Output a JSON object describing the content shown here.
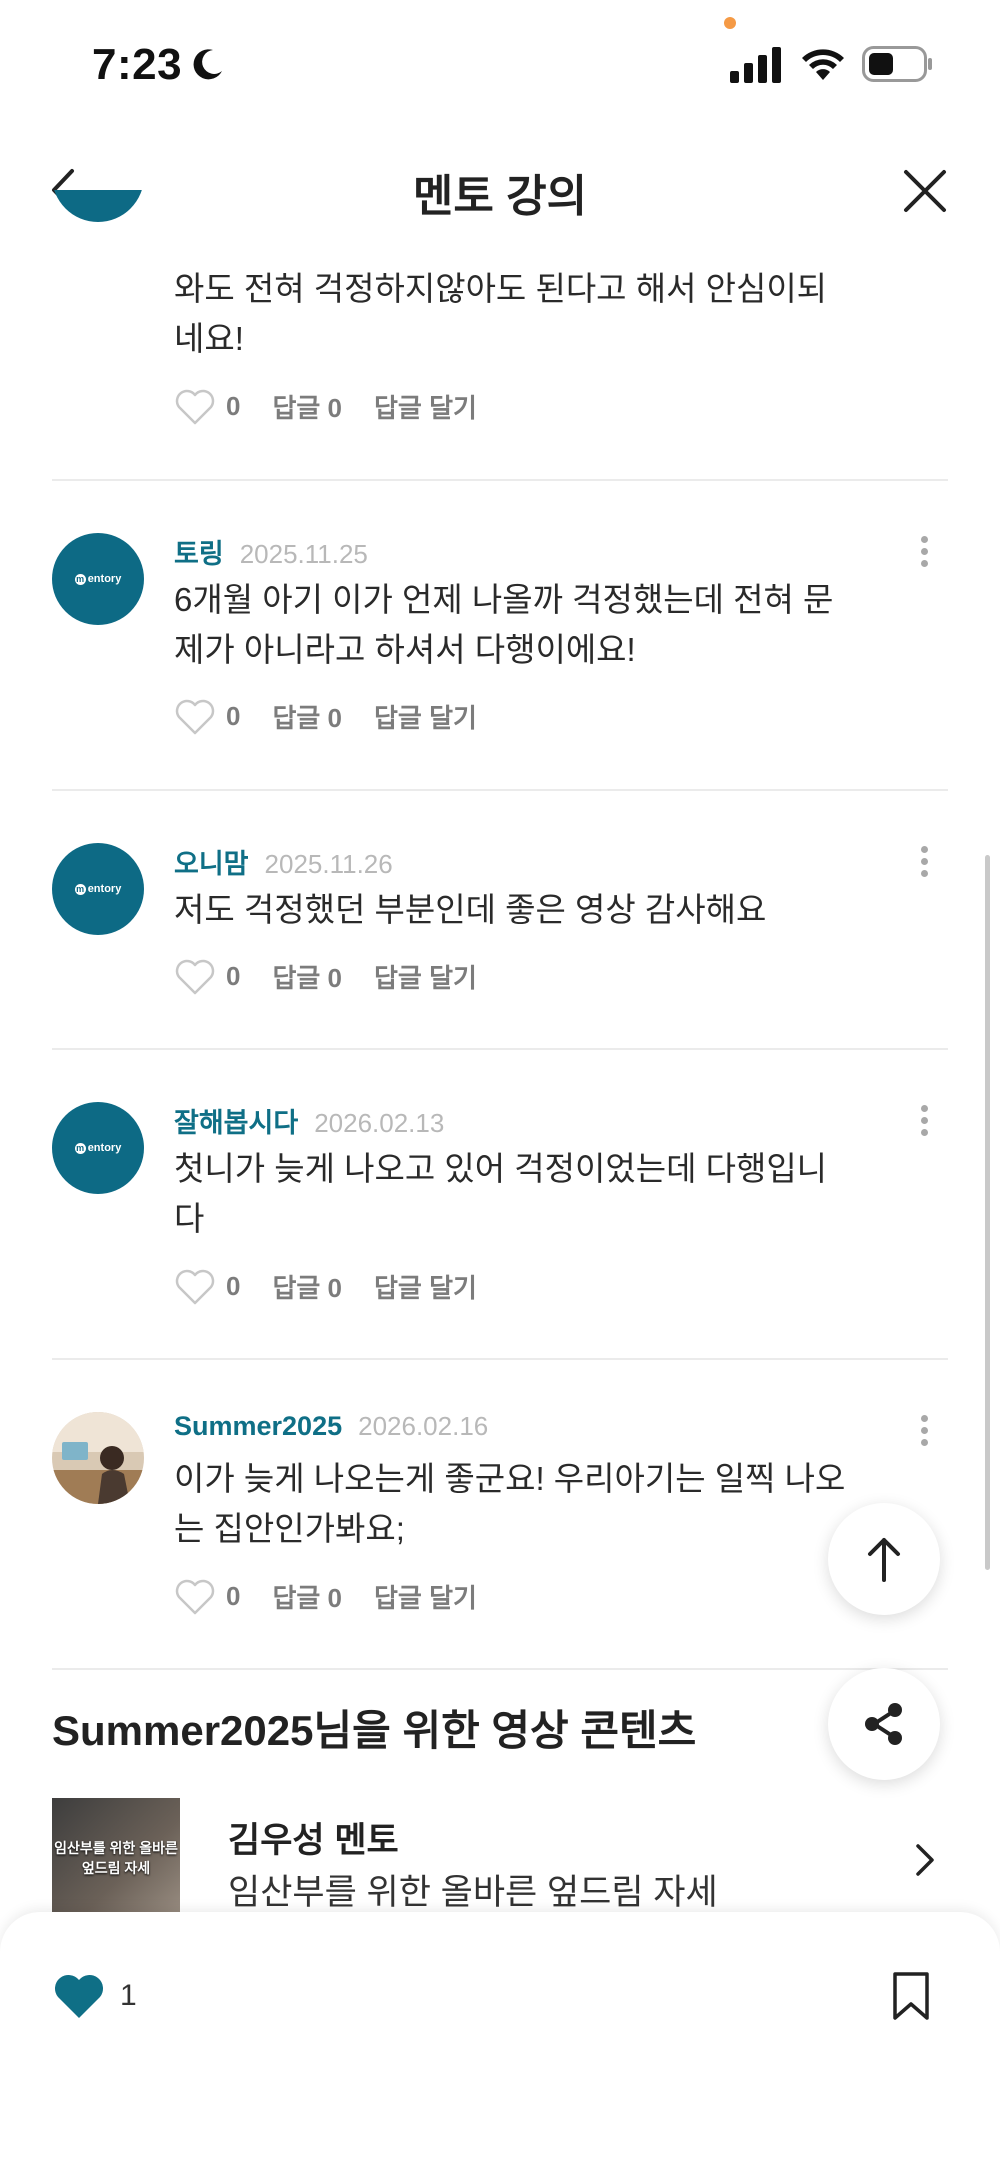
{
  "status_bar": {
    "time": "7:23"
  },
  "header": {
    "title": "멘토 강의"
  },
  "partial_comment": {
    "body": "와도 전혀 걱정하지않아도 된다고 해서 안심이되네요!",
    "likes": "0",
    "reply_count": "답글 0",
    "reply_action": "답글 달기"
  },
  "comments": [
    {
      "author": "토링",
      "date": "2025.11.25",
      "body": "6개월 아기 이가 언제 나올까 걱정했는데 전혀 문제가 아니라고 하셔서 다행이에요!",
      "likes": "0",
      "reply_count": "답글 0",
      "reply_action": "답글 달기",
      "avatar": "mentory-logo"
    },
    {
      "author": "오니맘",
      "date": "2025.11.26",
      "body": "저도 걱정했던 부분인데 좋은 영상 감사해요",
      "likes": "0",
      "reply_count": "답글 0",
      "reply_action": "답글 달기",
      "avatar": "mentory-logo"
    },
    {
      "author": "잘해봅시다",
      "date": "2026.02.13",
      "body": "첫니가 늦게 나오고 있어 걱정이었는데 다행입니다",
      "likes": "0",
      "reply_count": "답글 0",
      "reply_action": "답글 달기",
      "avatar": "mentory-logo"
    },
    {
      "author": "Summer2025",
      "date": "2026.02.16",
      "body": "이가 늦게 나오는게 좋군요! 우리아기는 일찍 나오는 집안인가봐요;",
      "likes": "0",
      "reply_count": "답글 0",
      "reply_action": "답글 달기",
      "avatar": "user-photo"
    }
  ],
  "avatar_logo_text": "entory",
  "recommendations": {
    "title": "Summer2025님을 위한 영상 콘텐츠",
    "items": [
      {
        "thumbnail_text": "임산부를 위한 올바른 엎드림 자세",
        "mentor": "김우성 멘토",
        "description": "임산부를 위한 올바른 엎드림 자세"
      }
    ]
  },
  "bottom_bar": {
    "like_count": "1"
  },
  "colors": {
    "accent": "#0f6f86",
    "avatar_bg": "#0d6a85",
    "muted": "#7c7c7c",
    "date": "#b8b8b8"
  },
  "icons": [
    "moon-icon",
    "signal-icon",
    "wifi-icon",
    "battery-icon",
    "back-icon",
    "close-icon",
    "more-icon",
    "heart-outline-icon",
    "arrow-up-icon",
    "share-icon",
    "chevron-right-icon",
    "heart-filled-icon",
    "bookmark-icon"
  ]
}
